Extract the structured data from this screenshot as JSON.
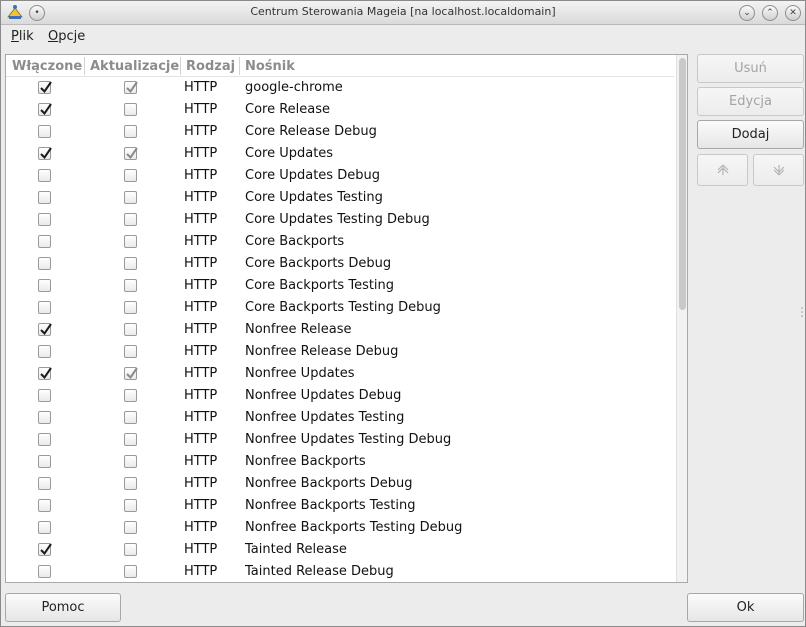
{
  "window": {
    "title": "Centrum Sterowania Mageia  [na localhost.localdomain]"
  },
  "menu": [
    {
      "label": "Plik",
      "underline": "P",
      "rest": "lik"
    },
    {
      "label": "Opcje",
      "underline": "O",
      "rest": "pcje"
    }
  ],
  "columns": {
    "enabled": "Włączone",
    "updates": "Aktualizacje",
    "type": "Rodzaj",
    "media": "Nośnik"
  },
  "rows": [
    {
      "enabled": true,
      "updates": true,
      "updates_disabled": true,
      "type": "HTTP",
      "name": "google-chrome"
    },
    {
      "enabled": true,
      "updates": false,
      "updates_disabled": false,
      "type": "HTTP",
      "name": "Core Release"
    },
    {
      "enabled": false,
      "updates": false,
      "updates_disabled": false,
      "type": "HTTP",
      "name": "Core Release Debug"
    },
    {
      "enabled": true,
      "updates": true,
      "updates_disabled": true,
      "type": "HTTP",
      "name": "Core Updates"
    },
    {
      "enabled": false,
      "updates": false,
      "updates_disabled": false,
      "type": "HTTP",
      "name": "Core Updates Debug"
    },
    {
      "enabled": false,
      "updates": false,
      "updates_disabled": false,
      "type": "HTTP",
      "name": "Core Updates Testing"
    },
    {
      "enabled": false,
      "updates": false,
      "updates_disabled": false,
      "type": "HTTP",
      "name": "Core Updates Testing Debug"
    },
    {
      "enabled": false,
      "updates": false,
      "updates_disabled": false,
      "type": "HTTP",
      "name": "Core Backports"
    },
    {
      "enabled": false,
      "updates": false,
      "updates_disabled": false,
      "type": "HTTP",
      "name": "Core Backports Debug"
    },
    {
      "enabled": false,
      "updates": false,
      "updates_disabled": false,
      "type": "HTTP",
      "name": "Core Backports Testing"
    },
    {
      "enabled": false,
      "updates": false,
      "updates_disabled": false,
      "type": "HTTP",
      "name": "Core Backports Testing Debug"
    },
    {
      "enabled": true,
      "updates": false,
      "updates_disabled": false,
      "type": "HTTP",
      "name": "Nonfree Release"
    },
    {
      "enabled": false,
      "updates": false,
      "updates_disabled": false,
      "type": "HTTP",
      "name": "Nonfree Release Debug"
    },
    {
      "enabled": true,
      "updates": true,
      "updates_disabled": true,
      "type": "HTTP",
      "name": "Nonfree Updates"
    },
    {
      "enabled": false,
      "updates": false,
      "updates_disabled": false,
      "type": "HTTP",
      "name": "Nonfree Updates Debug"
    },
    {
      "enabled": false,
      "updates": false,
      "updates_disabled": false,
      "type": "HTTP",
      "name": "Nonfree Updates Testing"
    },
    {
      "enabled": false,
      "updates": false,
      "updates_disabled": false,
      "type": "HTTP",
      "name": "Nonfree Updates Testing Debug"
    },
    {
      "enabled": false,
      "updates": false,
      "updates_disabled": false,
      "type": "HTTP",
      "name": "Nonfree Backports"
    },
    {
      "enabled": false,
      "updates": false,
      "updates_disabled": false,
      "type": "HTTP",
      "name": "Nonfree Backports Debug"
    },
    {
      "enabled": false,
      "updates": false,
      "updates_disabled": false,
      "type": "HTTP",
      "name": "Nonfree Backports Testing"
    },
    {
      "enabled": false,
      "updates": false,
      "updates_disabled": false,
      "type": "HTTP",
      "name": "Nonfree Backports Testing Debug"
    },
    {
      "enabled": true,
      "updates": false,
      "updates_disabled": false,
      "type": "HTTP",
      "name": "Tainted Release"
    },
    {
      "enabled": false,
      "updates": false,
      "updates_disabled": false,
      "type": "HTTP",
      "name": "Tainted Release Debug"
    }
  ],
  "side_buttons": {
    "remove": "Usuń",
    "edit": "Edycja",
    "add": "Dodaj"
  },
  "footer": {
    "help": "Pomoc",
    "ok": "Ok"
  },
  "icons": {
    "up": "arrow-up-icon",
    "down": "arrow-down-icon",
    "app": "mageia-control-center-icon"
  }
}
